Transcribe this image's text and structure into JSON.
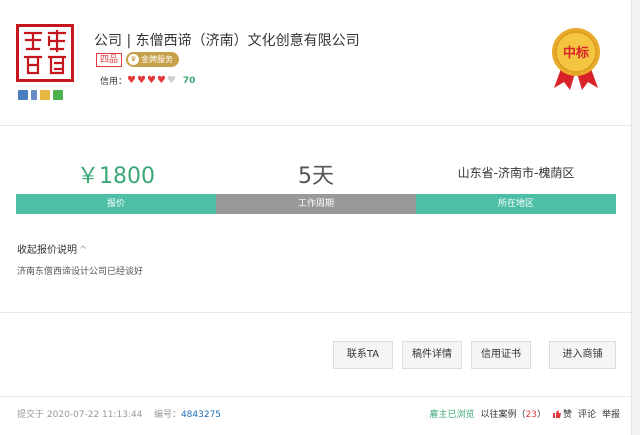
{
  "company": {
    "title": "公司 | 东僧西谛（济南）文化创意有限公司",
    "tag_level": "四品",
    "tag_gold": "金牌服务",
    "credit_label": "信用：",
    "credit_hearts": 4,
    "credit_hearts_total": 5,
    "credit_score": "70",
    "medal_text": "中标",
    "logo_text": "東僧西諦"
  },
  "stats": [
    {
      "value": "￥1800",
      "label": "报价",
      "color": "#4dbfa4"
    },
    {
      "value": "5天",
      "label": "工作周期",
      "color": "#999999"
    },
    {
      "value": "山东省-济南市-槐荫区",
      "label": "所在地区",
      "color": "#4dbfa4"
    }
  ],
  "description": {
    "toggle": "收起报价说明",
    "text": "济南东僧西谛设计公司已经谈好"
  },
  "actions": [
    {
      "label": "联系TA"
    },
    {
      "label": "稿件详情"
    },
    {
      "label": "信用证书"
    },
    {
      "label": "进入商铺"
    }
  ],
  "footer": {
    "submitted_label": "提交于",
    "submitted_time": "2020-07-22 11:13:44",
    "number_label": "编号：",
    "number": "4843275",
    "viewed": "雇主已浏览",
    "cases_label": "以往案例（",
    "cases_count": "23",
    "cases_close": "）",
    "like": "赞",
    "comment": "评论",
    "report": "举报"
  },
  "colors": {
    "accent_green": "#3aa876",
    "bar_green": "#4dbfa4",
    "bar_gray": "#999999",
    "seal_red": "#c4161c",
    "gold": "#c7a04a"
  }
}
